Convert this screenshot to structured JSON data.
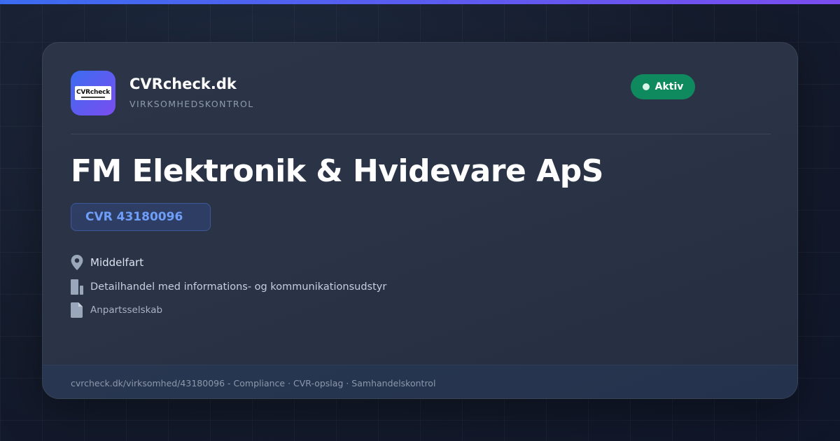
{
  "brand": {
    "logo_text": "CVRcheck",
    "name": "CVRcheck.dk",
    "tagline": "VIRKSOMHEDSKONTROL"
  },
  "status": {
    "label": "Aktiv",
    "color": "#0f8a5e"
  },
  "company": {
    "name": "FM Elektronik & Hvidevare ApS",
    "cvr": "CVR 43180096",
    "city": "Middelfart",
    "industry": "Detailhandel med informations- og kommunikationsudstyr",
    "type": "Anpartsselskab"
  },
  "icons": {
    "city": "location-pin-icon",
    "industry": "building-icon",
    "type": "document-icon"
  },
  "footer": {
    "text": "cvrcheck.dk/virksomhed/43180096 - Compliance · CVR-opslag · Samhandelskontrol"
  },
  "colors": {
    "accent": "#3b6cf0",
    "accent_secondary": "#7b4df0",
    "cvr_text": "#6f9ef8"
  }
}
